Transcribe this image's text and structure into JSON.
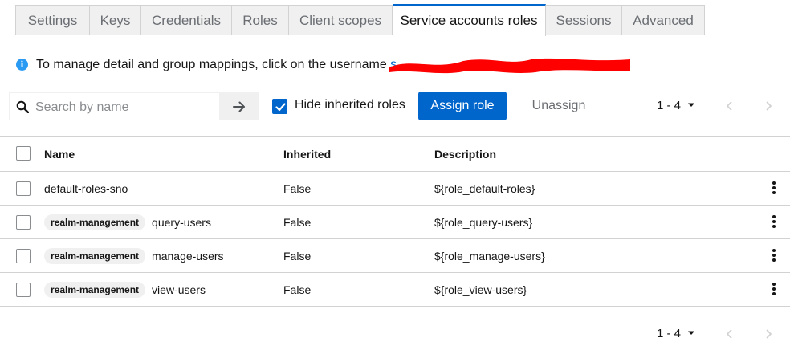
{
  "tabs": [
    {
      "label": "Settings",
      "active": false
    },
    {
      "label": "Keys",
      "active": false
    },
    {
      "label": "Credentials",
      "active": false
    },
    {
      "label": "Roles",
      "active": false
    },
    {
      "label": "Client scopes",
      "active": false
    },
    {
      "label": "Service accounts roles",
      "active": true
    },
    {
      "label": "Sessions",
      "active": false
    },
    {
      "label": "Advanced",
      "active": false
    }
  ],
  "alert": {
    "icon": "info-circle-icon",
    "text": "To manage detail and group mappings, click on the username ",
    "link_fragment": "s"
  },
  "toolbar": {
    "search_placeholder": "Search by name",
    "search_value": "",
    "hide_inherited_label": "Hide inherited roles",
    "hide_inherited_checked": true,
    "assign_label": "Assign role",
    "unassign_label": "Unassign"
  },
  "pagination": {
    "top_range": "1 - 4",
    "bottom_range": "1 - 4"
  },
  "table": {
    "columns": [
      "Name",
      "Inherited",
      "Description"
    ],
    "rows": [
      {
        "badge": "",
        "name": "default-roles-sno",
        "inherited": "False",
        "description": "${role_default-roles}"
      },
      {
        "badge": "realm-management",
        "name": "query-users",
        "inherited": "False",
        "description": "${role_query-users}"
      },
      {
        "badge": "realm-management",
        "name": "manage-users",
        "inherited": "False",
        "description": "${role_manage-users}"
      },
      {
        "badge": "realm-management",
        "name": "view-users",
        "inherited": "False",
        "description": "${role_view-users}"
      }
    ]
  },
  "colors": {
    "primary": "#0066cc",
    "redaction": "#ff0000",
    "border": "#d2d2d2"
  }
}
